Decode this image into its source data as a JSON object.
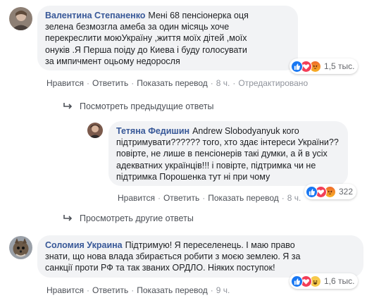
{
  "comments": [
    {
      "author": "Валентина Степаненко",
      "lines": [
        "Мені 68 пенсіонерка оця",
        "зелена безмозгла амеба за один місяць хоче",
        "перекреслити моюУкраїну ,життя моїх дітей ,моїх",
        "онуків .Я Перша поіду до Киева і буду голосувати",
        "за импичмент оцьому недоросля"
      ],
      "reaction_count": "1,5 тыс.",
      "reaction_icons": [
        "like-icon",
        "love-icon",
        "angry-icon"
      ],
      "actions": {
        "like": "Нравится",
        "reply": "Ответить",
        "translate": "Показать перевод",
        "time": "8 ч.",
        "edited": "Отредактировано"
      }
    },
    {
      "author": "Тетяна Федишин",
      "lines": [
        "Andrew Slobodyanyuk кого",
        "підтримувати?????? того, хто здає інтереси України??",
        "повірте, не лише в пенсіонерів такі думки, а й в усіх",
        "адекватних українців!!! і повірте, підтримка чи не",
        "підтримка Порошенка тут ні при чому"
      ],
      "reaction_count": "322",
      "reaction_icons": [
        "like-icon",
        "love-icon",
        "angry-icon"
      ],
      "actions": {
        "like": "Нравится",
        "reply": "Ответить",
        "translate": "Показать перевод",
        "time": "8 ч."
      }
    },
    {
      "author": "Соломия Украина",
      "lines": [
        "Підтримую! Я переселенець. І маю право",
        "знати, що нова влада збирається робити з моєю землею. Я за",
        "санкції проти РФ та так званих ОРДЛО. Ніяких поступок!"
      ],
      "reaction_count": "1,6 тыс.",
      "reaction_icons": [
        "like-icon",
        "love-icon",
        "haha-icon"
      ],
      "actions": {
        "like": "Нравится",
        "reply": "Ответить",
        "translate": "Показать перевод",
        "time": "9 ч."
      }
    }
  ],
  "view_previous_replies": "Посмотреть предыдущие ответы",
  "view_other_replies": "Просмотреть другие ответы",
  "colors": {
    "link": "#385898",
    "bubble": "#f2f3f5",
    "like": "#1877f2",
    "love": "#f33e58",
    "meta": "#90949c"
  }
}
